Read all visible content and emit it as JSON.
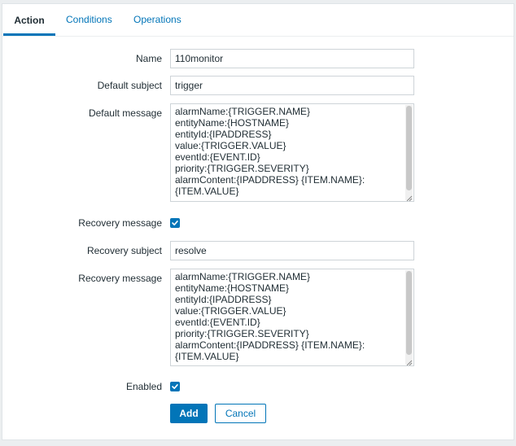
{
  "tabs": [
    {
      "label": "Action",
      "active": true
    },
    {
      "label": "Conditions",
      "active": false
    },
    {
      "label": "Operations",
      "active": false
    }
  ],
  "form": {
    "name": {
      "label": "Name",
      "value": "110monitor"
    },
    "default_subject": {
      "label": "Default subject",
      "value": "trigger"
    },
    "default_message": {
      "label": "Default message",
      "lines": [
        "alarmName:{TRIGGER.NAME}",
        "entityName:{HOSTNAME}",
        "entityId:{IPADDRESS}",
        "value:{TRIGGER.VALUE}",
        "eventId:{EVENT.ID}",
        "priority:{TRIGGER.SEVERITY}",
        "alarmContent:{IPADDRESS} {ITEM.NAME}:",
        "{ITEM.VALUE}"
      ]
    },
    "recovery_message_toggle": {
      "label": "Recovery message",
      "checked": true
    },
    "recovery_subject": {
      "label": "Recovery subject",
      "value": "resolve"
    },
    "recovery_message": {
      "label": "Recovery message",
      "lines": [
        "alarmName:{TRIGGER.NAME}",
        "entityName:{HOSTNAME}",
        "entityId:{IPADDRESS}",
        "value:{TRIGGER.VALUE}",
        "eventId:{EVENT.ID}",
        "priority:{TRIGGER.SEVERITY}",
        "alarmContent:{IPADDRESS} {ITEM.NAME}:",
        "{ITEM.VALUE}"
      ]
    },
    "enabled": {
      "label": "Enabled",
      "checked": true
    }
  },
  "buttons": {
    "add_label": "Add",
    "cancel_label": "Cancel"
  },
  "colors": {
    "accent": "#0275b8",
    "background": "#ebeef0",
    "text": "#1f2c33"
  },
  "icons": {
    "checkbox": "checkmark-icon",
    "resize": "resize-grip-icon"
  }
}
